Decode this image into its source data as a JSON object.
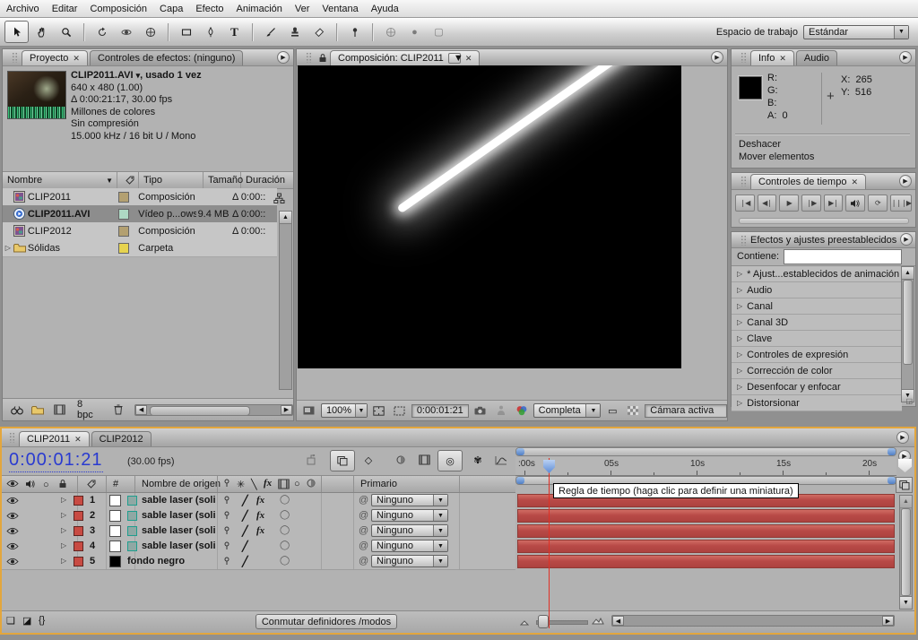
{
  "menu": {
    "items": [
      "Archivo",
      "Editar",
      "Composición",
      "Capa",
      "Efecto",
      "Animación",
      "Ver",
      "Ventana",
      "Ayuda"
    ]
  },
  "toolbar": {
    "tools": [
      "selection",
      "hand",
      "zoom",
      "rotation",
      "orbit-camera",
      "pan-behind",
      "rectangle",
      "pen",
      "text",
      "brush",
      "clone-stamp",
      "eraser",
      "puppet-pin"
    ],
    "workspace_label": "Espacio de trabajo",
    "workspace_value": "Estándar"
  },
  "project": {
    "tab": "Proyecto",
    "tab_effect_controls": "Controles de efectos: (ninguno)",
    "preview_title": "CLIP2011.AVI",
    "preview_title_suffix": ", usado 1 vez",
    "preview_lines": [
      "640 x 480 (1.00)",
      "Δ 0:00:21:17, 30.00 fps",
      "Millones de colores",
      "Sin compresión",
      "15.000 kHz / 16 bit U / Mono"
    ],
    "columns": {
      "name": "Nombre",
      "type": "Tipo",
      "size": "Tamaño",
      "duration": "Duración"
    },
    "rows": [
      {
        "name": "CLIP2011",
        "icon": "composition",
        "label_color": "#b3a071",
        "type": "Composición",
        "size": "",
        "duration": "Δ 0:00::",
        "selected": false
      },
      {
        "name": "CLIP2011.AVI",
        "icon": "video",
        "label_color": "#aed9c4",
        "type": "Vídeo p...ows",
        "size": "9.4 MB",
        "duration": "Δ 0:00::",
        "selected": true
      },
      {
        "name": "CLIP2012",
        "icon": "composition",
        "label_color": "#b3a071",
        "type": "Composición",
        "size": "",
        "duration": "Δ 0:00::",
        "selected": false
      },
      {
        "name": "Sólidas",
        "icon": "folder",
        "label_color": "#e6d34f",
        "type": "Carpeta",
        "size": "",
        "duration": "",
        "selected": false
      }
    ],
    "bit_depth": "8 bpc"
  },
  "comp": {
    "tab": "Composición: CLIP2011",
    "zoom": "100%",
    "timecode": "0:00:01:21",
    "resolution": "Completa",
    "camera": "Cámara activa"
  },
  "info": {
    "tab": "Info",
    "tab_audio": "Audio",
    "r": "R:",
    "g": "G:",
    "b": "B:",
    "a": "A:",
    "a_value": "0",
    "x_label": "X:",
    "x_value": "265",
    "y_label": "Y:",
    "y_value": "516",
    "history_line1": "Deshacer",
    "history_line2": "Mover elementos"
  },
  "time_controls": {
    "tab": "Controles de tiempo"
  },
  "effects": {
    "title": "Efectos y ajustes preestablecidos",
    "contains_label": "Contiene:",
    "search_value": "",
    "items": [
      "* Ajust...establecidos de animación",
      "Audio",
      "Canal",
      "Canal 3D",
      "Clave",
      "Controles de expresión",
      "Corrección de color",
      "Desenfocar y enfocar",
      "Distorsionar"
    ]
  },
  "timeline": {
    "tab1": "CLIP2011",
    "tab2": "CLIP2012",
    "timecode": "0:00:01:21",
    "fps": "(30.00 fps)",
    "col_hash": "#",
    "col_source": "Nombre de origen",
    "col_parent": "Primario",
    "layers": [
      {
        "num": "1",
        "name": "sable laser (soli",
        "swatch": "#ffffff",
        "fx": true,
        "parent": "Ninguno"
      },
      {
        "num": "2",
        "name": "sable laser (soli",
        "swatch": "#ffffff",
        "fx": true,
        "parent": "Ninguno"
      },
      {
        "num": "3",
        "name": "sable laser (soli",
        "swatch": "#ffffff",
        "fx": true,
        "parent": "Ninguno"
      },
      {
        "num": "4",
        "name": "sable laser (soli",
        "swatch": "#ffffff",
        "fx": false,
        "parent": "Ninguno"
      },
      {
        "num": "5",
        "name": "fondo negro",
        "swatch": "#000000",
        "fx": false,
        "parent": "Ninguno"
      }
    ],
    "ruler_labels": [
      ":00s",
      "05s",
      "10s",
      "15s",
      "20s"
    ],
    "tooltip": "Regla de tiempo (haga clic para definir una miniatura)",
    "modes_button": "Conmutar definidores /modos",
    "colors": {
      "layer_bar": "#b84a47",
      "label_chip": "#c84b43",
      "focus_border": "#e3a63d",
      "timecode_blue": "#2a3bd0"
    }
  }
}
